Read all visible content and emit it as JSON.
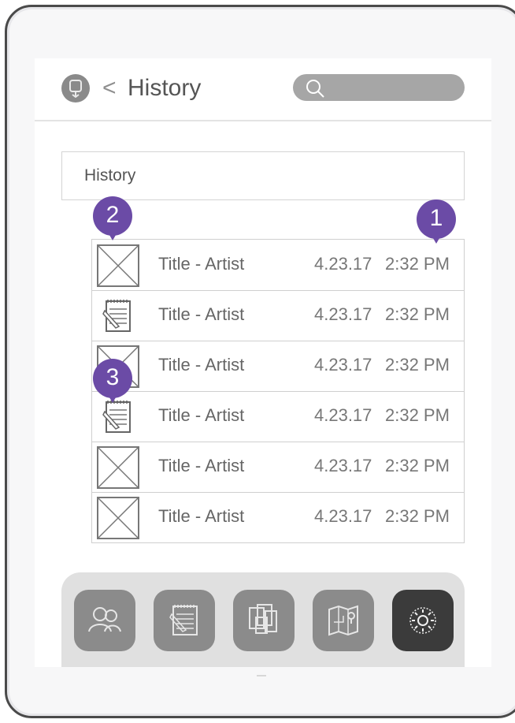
{
  "header": {
    "title": "History",
    "back_symbol": "<",
    "search_placeholder": ""
  },
  "section": {
    "label": "History"
  },
  "history_rows": [
    {
      "title": "Title - Artist",
      "date": "4.23.17",
      "time": "2:32 PM",
      "thumb_icon": "image-placeholder-icon"
    },
    {
      "title": "Title - Artist",
      "date": "4.23.17",
      "time": "2:32 PM",
      "thumb_icon": "notepad-icon"
    },
    {
      "title": "Title - Artist",
      "date": "4.23.17",
      "time": "2:32 PM",
      "thumb_icon": "image-placeholder-icon"
    },
    {
      "title": "Title - Artist",
      "date": "4.23.17",
      "time": "2:32 PM",
      "thumb_icon": "notepad-icon"
    },
    {
      "title": "Title - Artist",
      "date": "4.23.17",
      "time": "2:32 PM",
      "thumb_icon": "image-placeholder-icon"
    },
    {
      "title": "Title - Artist",
      "date": "4.23.17",
      "time": "2:32 PM",
      "thumb_icon": "image-placeholder-icon"
    }
  ],
  "callouts": [
    "1",
    "2",
    "3"
  ],
  "dock": [
    {
      "icon": "people-icon",
      "active": false
    },
    {
      "icon": "notepad-icon",
      "active": false
    },
    {
      "icon": "gallery-icon",
      "active": false
    },
    {
      "icon": "map-icon",
      "active": false
    },
    {
      "icon": "settings-gear-icon",
      "active": true
    }
  ],
  "colors": {
    "accent_callout": "#6b4ba6",
    "dock_button": "#8b8b8b",
    "dock_button_active": "#3b3b3b",
    "search_bg": "#a6a6a6"
  }
}
